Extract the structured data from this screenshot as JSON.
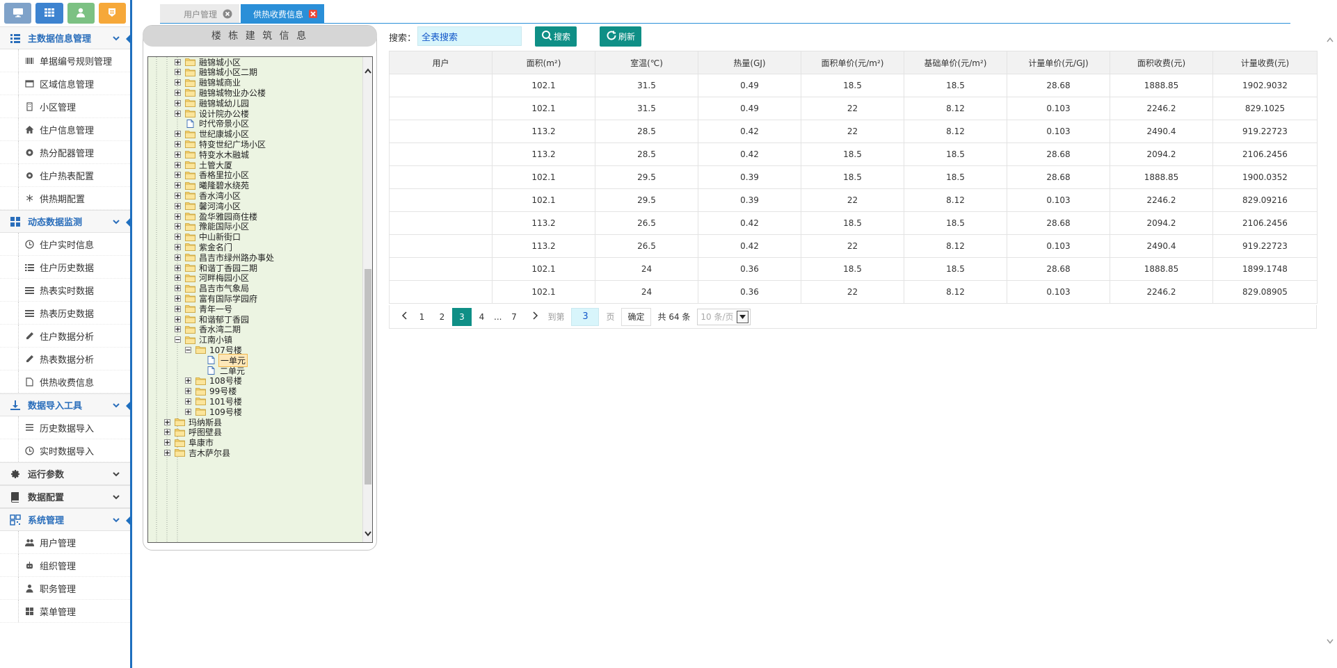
{
  "toolbar": {
    "buttons": [
      {
        "icon": "monitor-icon",
        "color": "#7fa2c9"
      },
      {
        "icon": "grid-icon",
        "color": "#3d83d0"
      },
      {
        "icon": "user-icon",
        "color": "#7cc183"
      },
      {
        "icon": "badge-icon",
        "color": "#f6a839"
      }
    ]
  },
  "sidebar": {
    "accent": "#1e6fbf",
    "groups": [
      {
        "label": "主数据信息管理",
        "items": [
          "单据编号规则管理",
          "区域信息管理",
          "小区管理",
          "住户信息管理",
          "热分配器管理",
          "住户热表配置",
          "供热期配置"
        ]
      },
      {
        "label": "动态数据监测",
        "items": [
          "住户实时信息",
          "住户历史数据",
          "热表实时数据",
          "热表历史数据",
          "住户数据分析",
          "热表数据分析",
          "供热收费信息"
        ]
      },
      {
        "label": "数据导入工具",
        "items": [
          "历史数据导入",
          "实时数据导入"
        ]
      },
      {
        "label": "运行参数",
        "items": []
      },
      {
        "label": "数据配置",
        "items": []
      },
      {
        "label": "系统管理",
        "items": [
          "用户管理",
          "组织管理",
          "职务管理",
          "菜单管理"
        ]
      }
    ]
  },
  "tabs": [
    {
      "label": "用户管理",
      "active": false
    },
    {
      "label": "供热收费信息",
      "active": true
    }
  ],
  "tree": {
    "title": "楼 栋 建 筑 信 息",
    "nodes": [
      {
        "label": "融锦城小区",
        "level": 3,
        "type": "folder",
        "expand": "plus"
      },
      {
        "label": "融锦城小区二期",
        "level": 3,
        "type": "folder",
        "expand": "plus"
      },
      {
        "label": "融锦城商业",
        "level": 3,
        "type": "folder",
        "expand": "plus"
      },
      {
        "label": "融锦城物业办公楼",
        "level": 3,
        "type": "folder",
        "expand": "plus"
      },
      {
        "label": "融锦城幼儿园",
        "level": 3,
        "type": "folder",
        "expand": "plus"
      },
      {
        "label": "设计院办公楼",
        "level": 3,
        "type": "folder",
        "expand": "plus"
      },
      {
        "label": "时代帝景小区",
        "level": 3,
        "type": "file",
        "expand": "none"
      },
      {
        "label": "世纪康城小区",
        "level": 3,
        "type": "folder",
        "expand": "plus"
      },
      {
        "label": "特变世纪广场小区",
        "level": 3,
        "type": "folder",
        "expand": "plus"
      },
      {
        "label": "特变水木融城",
        "level": 3,
        "type": "folder",
        "expand": "plus"
      },
      {
        "label": "土管大厦",
        "level": 3,
        "type": "folder",
        "expand": "plus"
      },
      {
        "label": "香格里拉小区",
        "level": 3,
        "type": "folder",
        "expand": "plus"
      },
      {
        "label": "曦隆碧水绕苑",
        "level": 3,
        "type": "folder",
        "expand": "plus"
      },
      {
        "label": "香水湾小区",
        "level": 3,
        "type": "folder",
        "expand": "plus"
      },
      {
        "label": "馨河湾小区",
        "level": 3,
        "type": "folder",
        "expand": "plus"
      },
      {
        "label": "盈华雅园商住楼",
        "level": 3,
        "type": "folder",
        "expand": "plus"
      },
      {
        "label": "豫能国际小区",
        "level": 3,
        "type": "folder",
        "expand": "plus"
      },
      {
        "label": "中山新街口",
        "level": 3,
        "type": "folder",
        "expand": "plus"
      },
      {
        "label": "紫金名门",
        "level": 3,
        "type": "folder",
        "expand": "plus"
      },
      {
        "label": "昌吉市绿州路办事处",
        "level": 3,
        "type": "folder",
        "expand": "plus"
      },
      {
        "label": "和谐丁香园二期",
        "level": 3,
        "type": "folder",
        "expand": "plus"
      },
      {
        "label": "河畔梅园小区",
        "level": 3,
        "type": "folder",
        "expand": "plus"
      },
      {
        "label": "昌吉市气象局",
        "level": 3,
        "type": "folder",
        "expand": "plus"
      },
      {
        "label": "富有国际学园府",
        "level": 3,
        "type": "folder",
        "expand": "plus"
      },
      {
        "label": "青年一号",
        "level": 3,
        "type": "folder",
        "expand": "plus"
      },
      {
        "label": "和谐郁丁香园",
        "level": 3,
        "type": "folder",
        "expand": "plus"
      },
      {
        "label": "香水湾二期",
        "level": 3,
        "type": "folder",
        "expand": "plus"
      },
      {
        "label": "江南小镇",
        "level": 3,
        "type": "folder",
        "expand": "minus"
      },
      {
        "label": "107号楼",
        "level": 4,
        "type": "folder",
        "expand": "minus"
      },
      {
        "label": "一单元",
        "level": 5,
        "type": "file",
        "expand": "none",
        "selected": true
      },
      {
        "label": "二单元",
        "level": 5,
        "type": "file",
        "expand": "none"
      },
      {
        "label": "108号楼",
        "level": 4,
        "type": "folder",
        "expand": "plus"
      },
      {
        "label": "99号楼",
        "level": 4,
        "type": "folder",
        "expand": "plus"
      },
      {
        "label": "101号楼",
        "level": 4,
        "type": "folder",
        "expand": "plus"
      },
      {
        "label": "109号楼",
        "level": 4,
        "type": "folder",
        "expand": "plus"
      },
      {
        "label": "玛纳斯县",
        "level": 2,
        "type": "folder",
        "expand": "plus"
      },
      {
        "label": "呼图壁县",
        "level": 2,
        "type": "folder",
        "expand": "plus"
      },
      {
        "label": "阜康市",
        "level": 2,
        "type": "folder",
        "expand": "plus"
      },
      {
        "label": "吉木萨尔县",
        "level": 2,
        "type": "folder",
        "expand": "plus"
      }
    ]
  },
  "search": {
    "label": "搜索：",
    "value": "全表搜索",
    "search_button": "搜索",
    "refresh_button": "刷新"
  },
  "table": {
    "columns": [
      "用户",
      "面积(m²)",
      "室温(℃)",
      "热量(GJ)",
      "面积单价(元/m²)",
      "基础单价(元/m²)",
      "计量单价(元/GJ)",
      "面积收费(元)",
      "计量收费(元)"
    ],
    "rows": [
      [
        "",
        "102.1",
        "31.5",
        "0.49",
        "18.5",
        "18.5",
        "28.68",
        "1888.85",
        "1902.9032"
      ],
      [
        "",
        "102.1",
        "31.5",
        "0.49",
        "22",
        "8.12",
        "0.103",
        "2246.2",
        "829.1025"
      ],
      [
        "",
        "113.2",
        "28.5",
        "0.42",
        "22",
        "8.12",
        "0.103",
        "2490.4",
        "919.22723"
      ],
      [
        "",
        "113.2",
        "28.5",
        "0.42",
        "18.5",
        "18.5",
        "28.68",
        "2094.2",
        "2106.2456"
      ],
      [
        "",
        "102.1",
        "29.5",
        "0.39",
        "18.5",
        "18.5",
        "28.68",
        "1888.85",
        "1900.0352"
      ],
      [
        "",
        "102.1",
        "29.5",
        "0.39",
        "22",
        "8.12",
        "0.103",
        "2246.2",
        "829.09216"
      ],
      [
        "",
        "113.2",
        "26.5",
        "0.42",
        "18.5",
        "18.5",
        "28.68",
        "2094.2",
        "2106.2456"
      ],
      [
        "",
        "113.2",
        "26.5",
        "0.42",
        "22",
        "8.12",
        "0.103",
        "2490.4",
        "919.22723"
      ],
      [
        "",
        "102.1",
        "24",
        "0.36",
        "18.5",
        "18.5",
        "28.68",
        "1888.85",
        "1899.1748"
      ],
      [
        "",
        "102.1",
        "24",
        "0.36",
        "22",
        "8.12",
        "0.103",
        "2246.2",
        "829.08905"
      ]
    ]
  },
  "pager": {
    "pages": [
      "1",
      "2",
      "3",
      "4"
    ],
    "current": "3",
    "ellipsis": "...",
    "last_page": "7",
    "goto_label": "到第",
    "goto_value": "3",
    "page_unit": "页",
    "confirm": "确定",
    "total": "共 64 条",
    "page_size": "10 条/页"
  },
  "colors": {
    "tab_active": "#2a8fd8",
    "button_teal": "#0f8f86",
    "tree_bg": "#ecf4e2",
    "input_bg": "#d8f5fb"
  }
}
